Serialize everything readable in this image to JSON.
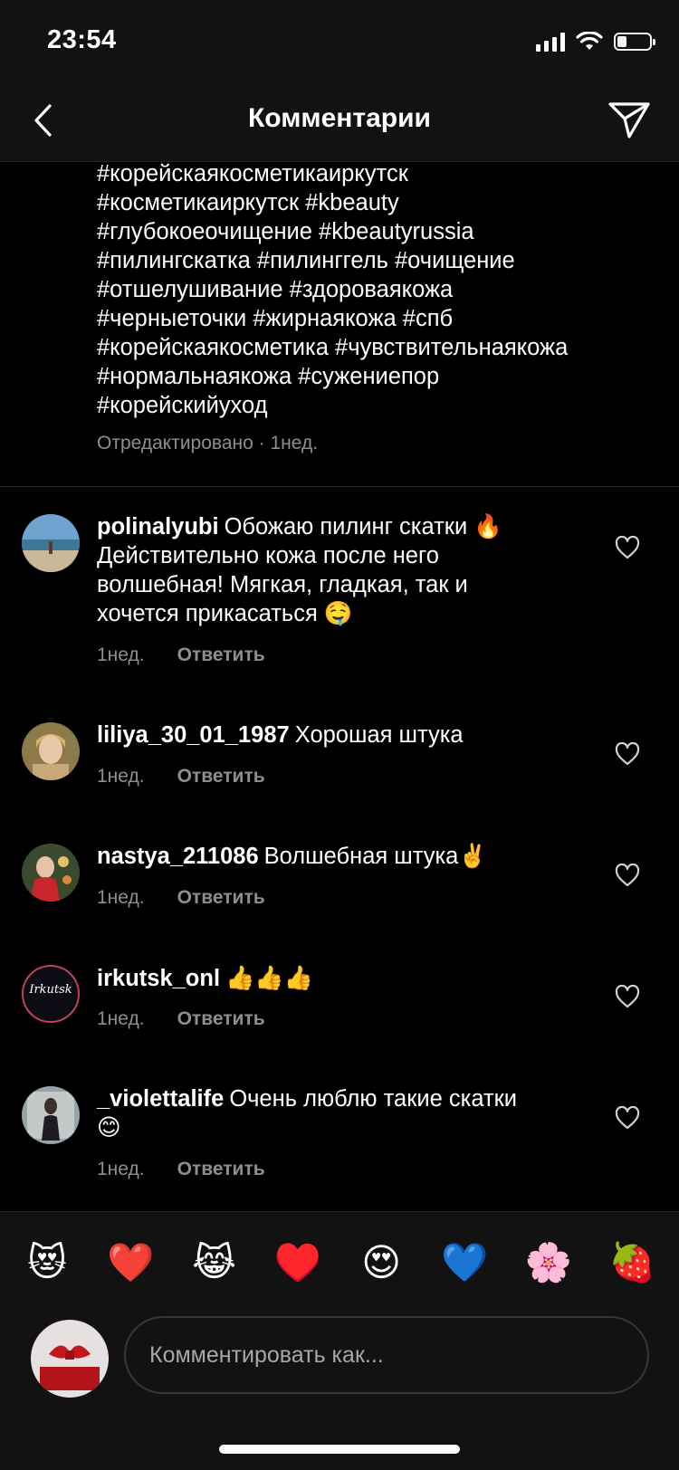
{
  "status_bar": {
    "time": "23:54"
  },
  "header": {
    "title": "Комментарии",
    "back_icon": "chevron-left-icon",
    "share_icon": "paper-plane-icon"
  },
  "caption": {
    "lines": [
      "#корейскаякосметикаиркутск",
      "#косметикаиркутск #kbeauty",
      "#глубокоеочищение #kbeautyrussia",
      "#пилингскатка #пилинггель #очищение",
      "#отшелушивание #здороваякожа",
      "#черныеточки #жирнаякожа #спб",
      "#корейскаякосметика #чувствительнаякожа",
      "#нормальнаякожа #сужениепор",
      "#корейскийуход"
    ],
    "meta": "Отредактировано · 1нед."
  },
  "comments": [
    {
      "username": "polinalyubi",
      "text_lines": [
        "Обожаю пилинг скатки 🔥",
        "Действительно кожа после него",
        "волшебная! Мягкая, гладкая, так и",
        "хочется прикасаться 🤤"
      ],
      "time": "1нед.",
      "reply": "Ответить"
    },
    {
      "username": "liliya_30_01_1987",
      "text_lines": [
        "Хорошая штука"
      ],
      "time": "1нед.",
      "reply": "Ответить"
    },
    {
      "username": "nastya_211086",
      "text_lines": [
        "Волшебная штука✌️"
      ],
      "time": "1нед.",
      "reply": "Ответить"
    },
    {
      "username": "irkutsk_onl",
      "text_lines": [
        "👍👍👍"
      ],
      "time": "1нед.",
      "reply": "Ответить",
      "avatar_text": "Irkutsk"
    },
    {
      "username": "_violettalife",
      "text_lines": [
        "Очень люблю такие скатки",
        "😊"
      ],
      "time": "1нед.",
      "reply": "Ответить"
    }
  ],
  "reactions": [
    "😻",
    "❤️",
    "😹",
    "♥️",
    "😍",
    "💙",
    "🌸",
    "🍓"
  ],
  "composer": {
    "placeholder": "Комментировать как..."
  },
  "colors": {
    "background": "#000000",
    "bar_background": "#121212",
    "secondary_text": "#8e8e8e",
    "divider": "#262626"
  }
}
